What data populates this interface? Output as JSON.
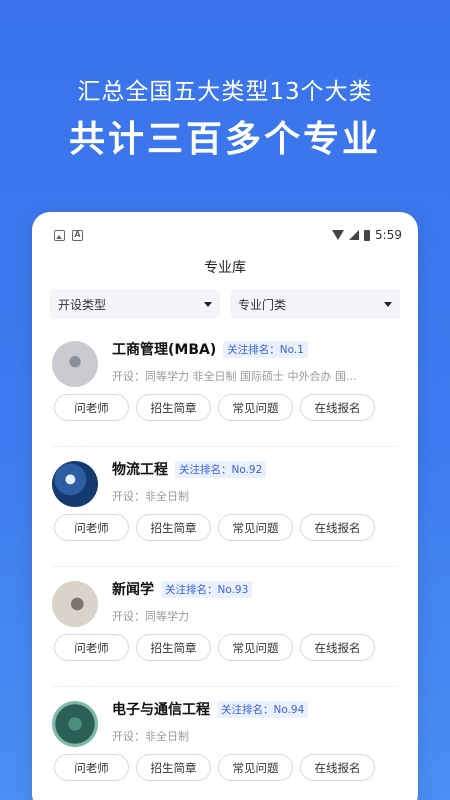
{
  "headline": {
    "line1": "汇总全国五大类型13个大类",
    "line2": "共计三百多个专业"
  },
  "status_bar": {
    "time": "5:59"
  },
  "page": {
    "title": "专业库"
  },
  "filters": [
    {
      "label": "开设类型"
    },
    {
      "label": "专业门类"
    }
  ],
  "majors": [
    {
      "name": "工商管理(MBA)",
      "rank": "关注排名：No.1",
      "desc": "开设：同等学力  非全日制  国际硕士  中外合办  国...",
      "buttons": [
        "问老师",
        "招生简章",
        "常见问题",
        "在线报名"
      ]
    },
    {
      "name": "物流工程",
      "rank": "关注排名：No.92",
      "desc": "开设：非全日制",
      "buttons": [
        "问老师",
        "招生简章",
        "常见问题",
        "在线报名"
      ]
    },
    {
      "name": "新闻学",
      "rank": "关注排名：No.93",
      "desc": "开设：同等学力",
      "buttons": [
        "问老师",
        "招生简章",
        "常见问题",
        "在线报名"
      ]
    },
    {
      "name": "电子与通信工程",
      "rank": "关注排名：No.94",
      "desc": "开设：非全日制",
      "buttons": [
        "问老师",
        "招生简章",
        "常见问题",
        "在线报名"
      ]
    }
  ]
}
